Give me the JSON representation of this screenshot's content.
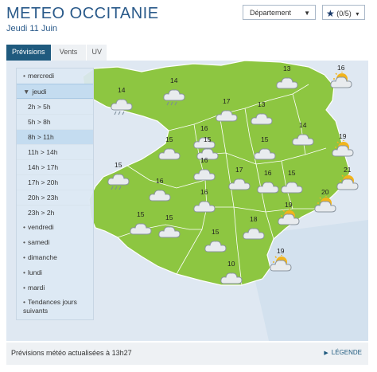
{
  "header": {
    "title": "METEO OCCITANIE",
    "date": "Jeudi 11 Juin",
    "department_select": "Département",
    "favorites": "(0/5)"
  },
  "tabs": [
    {
      "label": "Prévisions"
    },
    {
      "label": "Vents"
    },
    {
      "label": "UV"
    }
  ],
  "menu": {
    "days_before": [
      "mercredi"
    ],
    "selected_day": "jeudi",
    "slots": [
      "2h > 5h",
      "5h > 8h",
      "8h > 11h",
      "11h > 14h",
      "14h > 17h",
      "17h > 20h",
      "20h > 23h",
      "23h > 2h"
    ],
    "active_slot": "8h > 11h",
    "days_after": [
      "vendredi",
      "samedi",
      "dimanche",
      "lundi",
      "mardi"
    ],
    "trends": "Tendances jours suivants"
  },
  "forecast": [
    {
      "temp": "14",
      "icon": "rain-cloud-icon"
    },
    {
      "temp": "14",
      "icon": "rain-cloud-icon"
    },
    {
      "temp": "13",
      "icon": "cloud-icon"
    },
    {
      "temp": "16",
      "icon": "sun-cloud-icon"
    },
    {
      "temp": "17",
      "icon": "cloud-icon"
    },
    {
      "temp": "13",
      "icon": "cloud-icon"
    },
    {
      "temp": "16",
      "icon": "cloud-icon"
    },
    {
      "temp": "14",
      "icon": "cloud-icon"
    },
    {
      "temp": "15",
      "icon": "cloud-icon"
    },
    {
      "temp": "15",
      "icon": "cloud-icon"
    },
    {
      "temp": "15",
      "icon": "cloud-icon"
    },
    {
      "temp": "19",
      "icon": "sun-cloud-icon"
    },
    {
      "temp": "15",
      "icon": "rain-cloud-icon"
    },
    {
      "temp": "16",
      "icon": "cloud-icon"
    },
    {
      "temp": "17",
      "icon": "cloud-icon"
    },
    {
      "temp": "16",
      "icon": "cloud-icon"
    },
    {
      "temp": "15",
      "icon": "cloud-icon"
    },
    {
      "temp": "21",
      "icon": "sun-cloud-icon"
    },
    {
      "temp": "16",
      "icon": "cloud-icon"
    },
    {
      "temp": "16",
      "icon": "cloud-icon"
    },
    {
      "temp": "20",
      "icon": "sun-cloud-icon"
    },
    {
      "temp": "15",
      "icon": "cloud-icon"
    },
    {
      "temp": "15",
      "icon": "cloud-icon"
    },
    {
      "temp": "18",
      "icon": "cloud-icon"
    },
    {
      "temp": "19",
      "icon": "sun-cloud-icon"
    },
    {
      "temp": "15",
      "icon": "cloud-icon"
    },
    {
      "temp": "19",
      "icon": "sun-cloud-icon"
    },
    {
      "temp": "10",
      "icon": "cloud-icon"
    }
  ],
  "footer": {
    "update_text": "Prévisions météo actualisées à 13h27",
    "legend": "LÉGENDE"
  }
}
